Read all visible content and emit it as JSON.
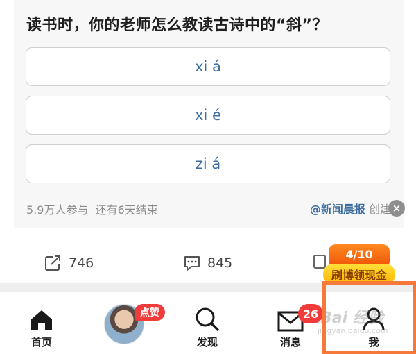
{
  "poll": {
    "question": "读书时，你的老师怎么教读古诗中的“斜”？",
    "options": [
      {
        "label": "xi á"
      },
      {
        "label": "xi é"
      },
      {
        "label": "zi á"
      }
    ],
    "participants": "5.9万人参与",
    "remaining": "还有6天结束",
    "author": "@新闻晨报",
    "author_action": "创建",
    "close_icon": "×"
  },
  "stats": {
    "shares": "746",
    "comments": "845"
  },
  "promo": {
    "count": "4/10",
    "label": "刷博领现金"
  },
  "tabbar": {
    "home": "首页",
    "avatar_badge": "点赞",
    "discover": "发现",
    "messages": "消息",
    "messages_badge": "26",
    "me": "我"
  },
  "watermark": {
    "logo": "Bai 经验",
    "url": "jingyan.baidu.com"
  },
  "colors": {
    "link": "#3d6e9f",
    "badge": "#f23b3b",
    "promo_orange": "#f15a0a",
    "promo_yellow": "#ffc400",
    "highlight": "#f5793a"
  }
}
